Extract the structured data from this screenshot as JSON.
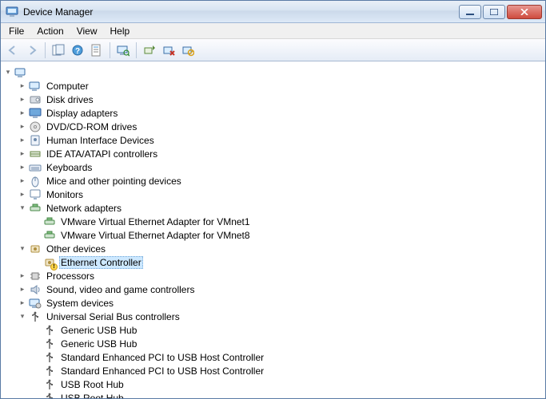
{
  "window": {
    "title": "Device Manager"
  },
  "menu": {
    "file": "File",
    "action": "Action",
    "view": "View",
    "help": "Help"
  },
  "toolbar": {
    "back": "Back",
    "forward": "Forward",
    "show_hidden": "Show hidden devices",
    "help": "Help",
    "properties": "Properties",
    "scan": "Scan for hardware changes",
    "update_driver": "Update Driver Software",
    "uninstall": "Uninstall",
    "disable": "Disable"
  },
  "tree": {
    "root": {
      "label": "",
      "expanded": true
    },
    "items": [
      {
        "id": "computer",
        "label": "Computer",
        "icon": "computer",
        "expanded": false,
        "children": []
      },
      {
        "id": "disk",
        "label": "Disk drives",
        "icon": "disk",
        "expanded": false,
        "children": []
      },
      {
        "id": "display",
        "label": "Display adapters",
        "icon": "display",
        "expanded": false,
        "children": []
      },
      {
        "id": "dvd",
        "label": "DVD/CD-ROM drives",
        "icon": "dvd",
        "expanded": false,
        "children": []
      },
      {
        "id": "hid",
        "label": "Human Interface Devices",
        "icon": "hid",
        "expanded": false,
        "children": []
      },
      {
        "id": "ide",
        "label": "IDE ATA/ATAPI controllers",
        "icon": "ide",
        "expanded": false,
        "children": []
      },
      {
        "id": "keyboard",
        "label": "Keyboards",
        "icon": "keyboard",
        "expanded": false,
        "children": []
      },
      {
        "id": "mice",
        "label": "Mice and other pointing devices",
        "icon": "mouse",
        "expanded": false,
        "children": []
      },
      {
        "id": "monitors",
        "label": "Monitors",
        "icon": "monitor",
        "expanded": false,
        "children": []
      },
      {
        "id": "network",
        "label": "Network adapters",
        "icon": "network",
        "expanded": true,
        "children": [
          {
            "id": "vmnet1",
            "label": "VMware Virtual Ethernet Adapter for VMnet1",
            "icon": "network"
          },
          {
            "id": "vmnet8",
            "label": "VMware Virtual Ethernet Adapter for VMnet8",
            "icon": "network"
          }
        ]
      },
      {
        "id": "other",
        "label": "Other devices",
        "icon": "other",
        "expanded": true,
        "children": [
          {
            "id": "ethctrl",
            "label": "Ethernet Controller",
            "icon": "other",
            "warn": true,
            "selected": true
          }
        ]
      },
      {
        "id": "processors",
        "label": "Processors",
        "icon": "cpu",
        "expanded": false,
        "children": []
      },
      {
        "id": "sound",
        "label": "Sound, video and game controllers",
        "icon": "sound",
        "expanded": false,
        "children": []
      },
      {
        "id": "system",
        "label": "System devices",
        "icon": "system",
        "expanded": false,
        "children": []
      },
      {
        "id": "usb",
        "label": "Universal Serial Bus controllers",
        "icon": "usb",
        "expanded": true,
        "children": [
          {
            "id": "usb1",
            "label": "Generic USB Hub",
            "icon": "usb"
          },
          {
            "id": "usb2",
            "label": "Generic USB Hub",
            "icon": "usb"
          },
          {
            "id": "usb3",
            "label": "Standard Enhanced PCI to USB Host Controller",
            "icon": "usb"
          },
          {
            "id": "usb4",
            "label": "Standard Enhanced PCI to USB Host Controller",
            "icon": "usb"
          },
          {
            "id": "usb5",
            "label": "USB Root Hub",
            "icon": "usb"
          },
          {
            "id": "usb6",
            "label": "USB Root Hub",
            "icon": "usb"
          }
        ]
      }
    ]
  }
}
